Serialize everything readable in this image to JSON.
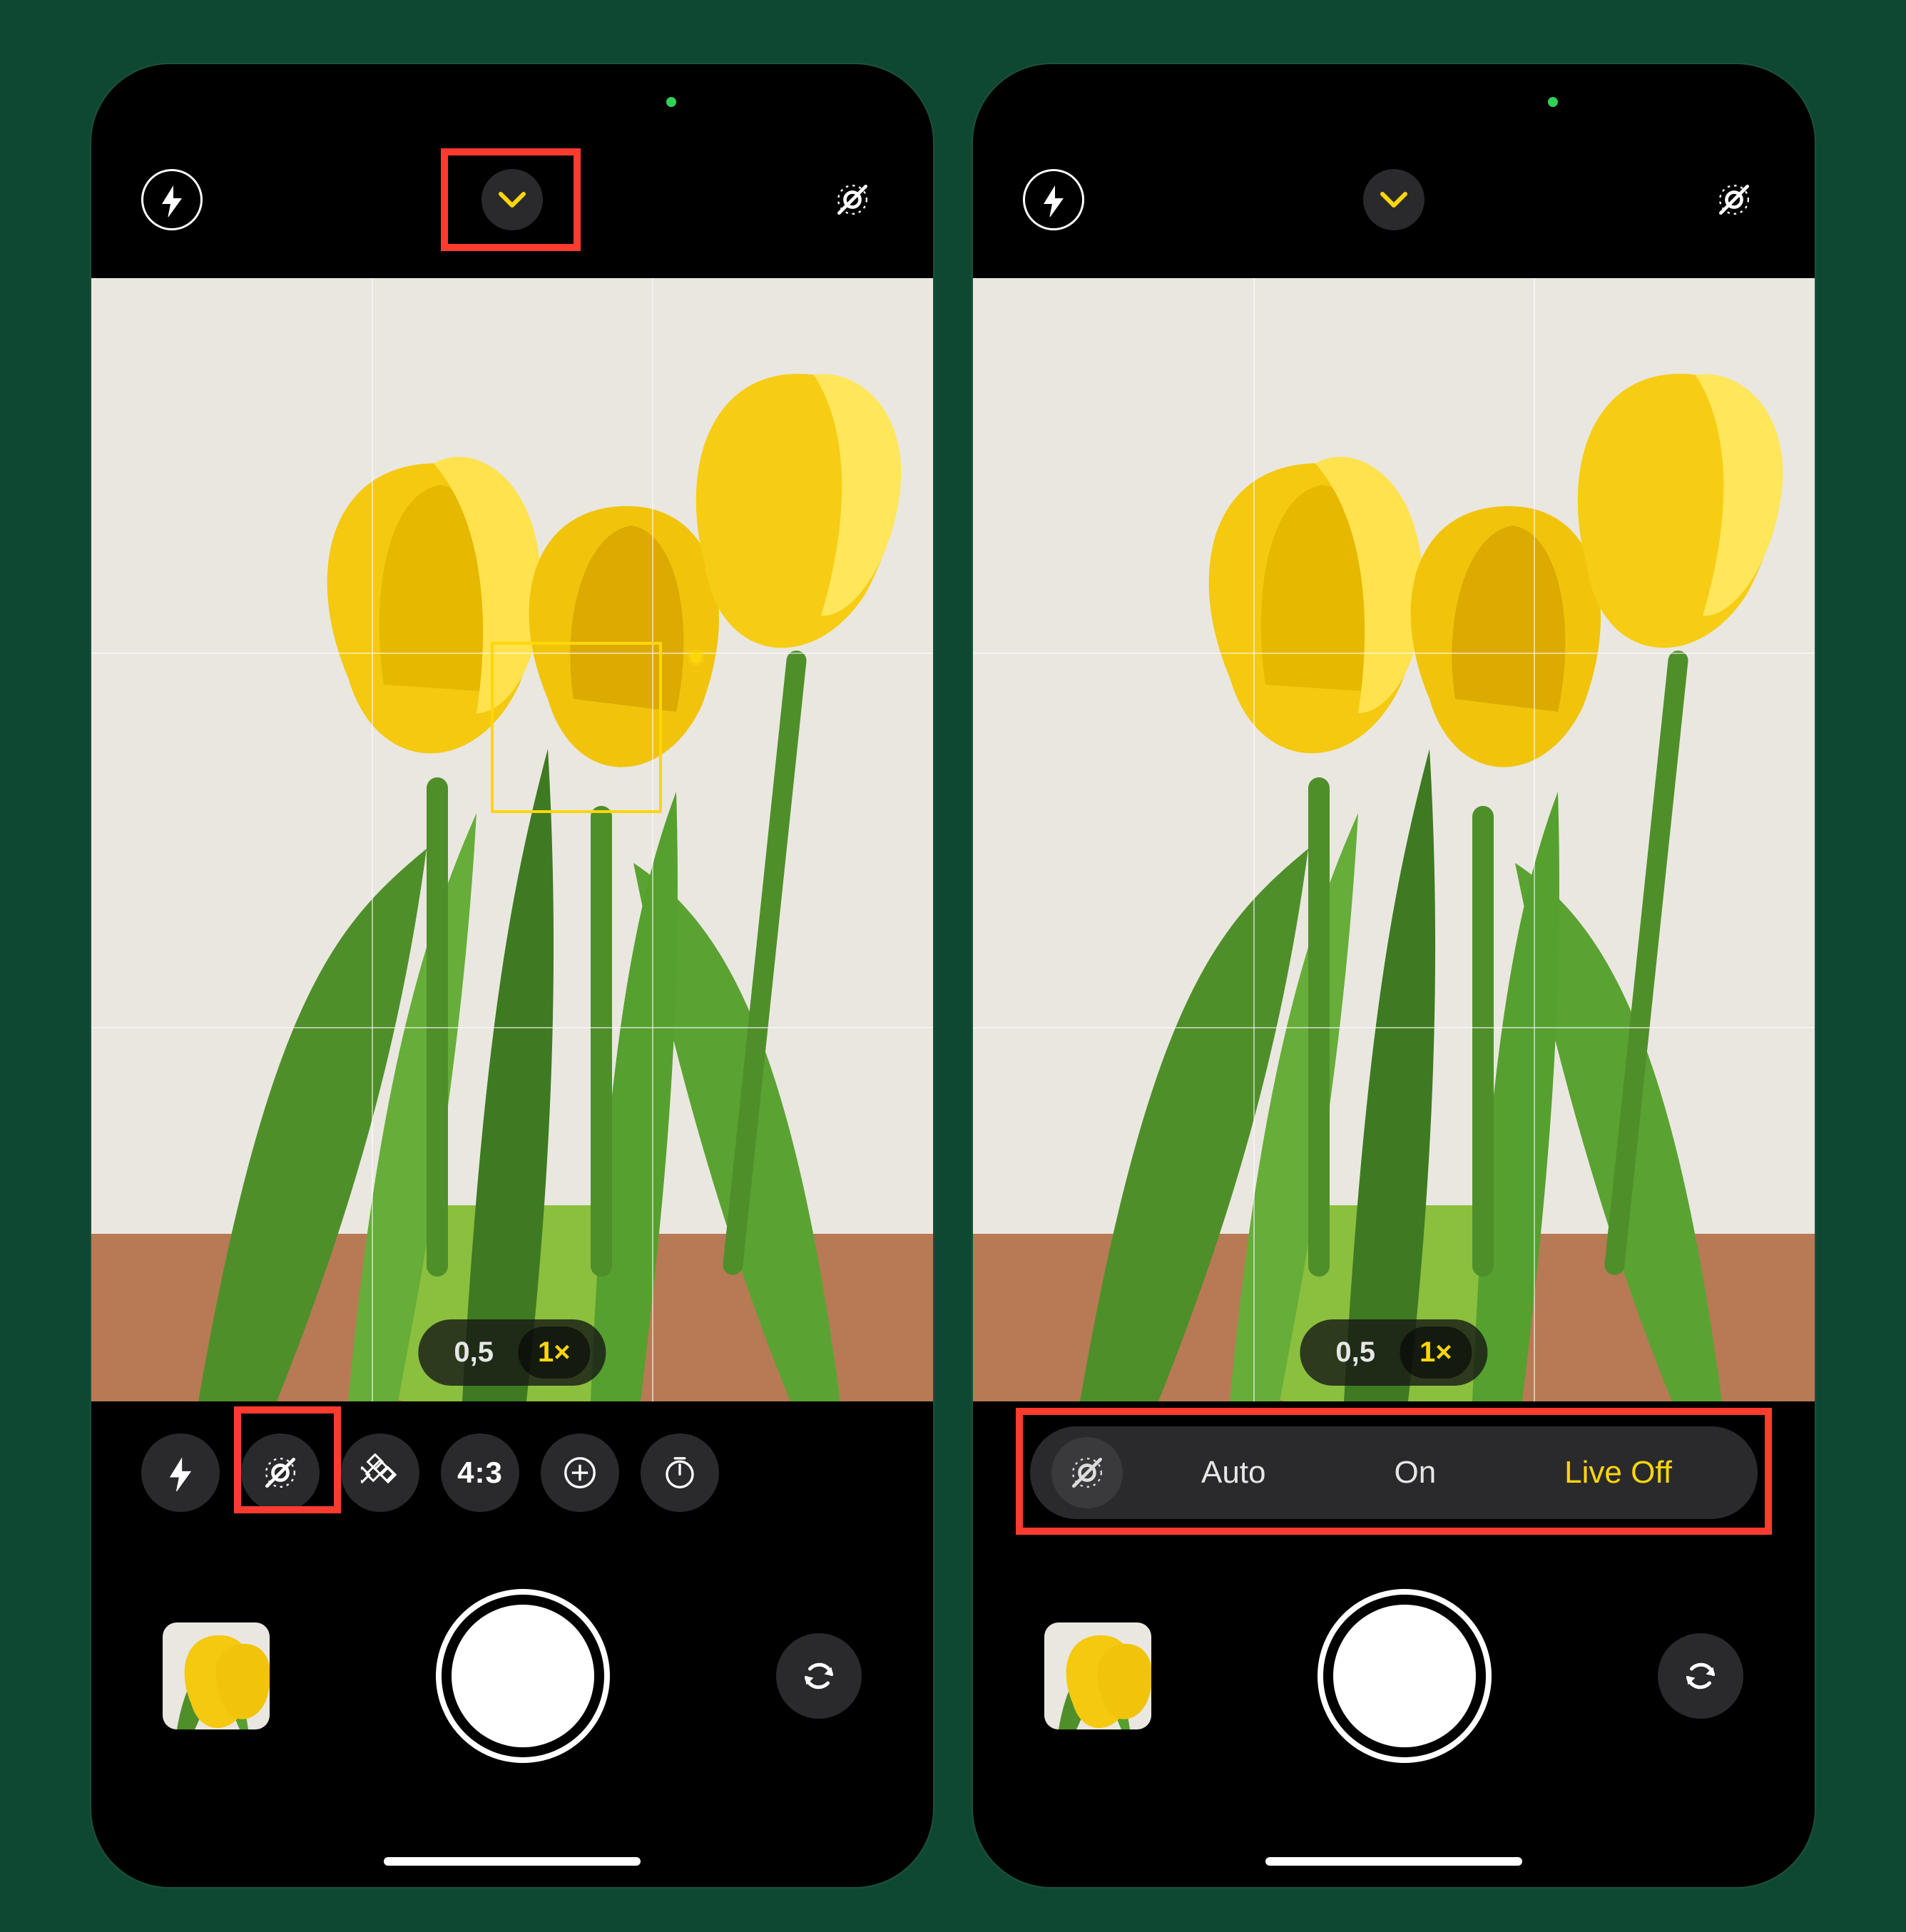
{
  "left": {
    "zoom": {
      "wide": "0,5",
      "standard": "1×",
      "selected": "standard"
    },
    "tool_aspect": "4:3",
    "highlights": [
      "chevron",
      "live-tool"
    ]
  },
  "right": {
    "zoom": {
      "wide": "0,5",
      "standard": "1×",
      "selected": "standard"
    },
    "live_options": {
      "auto": "Auto",
      "on": "On",
      "off": "Live Off",
      "selected": "off"
    },
    "highlights": [
      "live-pill"
    ]
  },
  "icons": {
    "flash": "bolt",
    "chevron": "chevron-down",
    "live_off": "live-photo-off",
    "filters": "filters",
    "exposure": "exposure-dial",
    "timer": "timer",
    "flip": "camera-flip"
  },
  "colors": {
    "accent": "#ffd60a",
    "highlight": "#ff3b30"
  }
}
